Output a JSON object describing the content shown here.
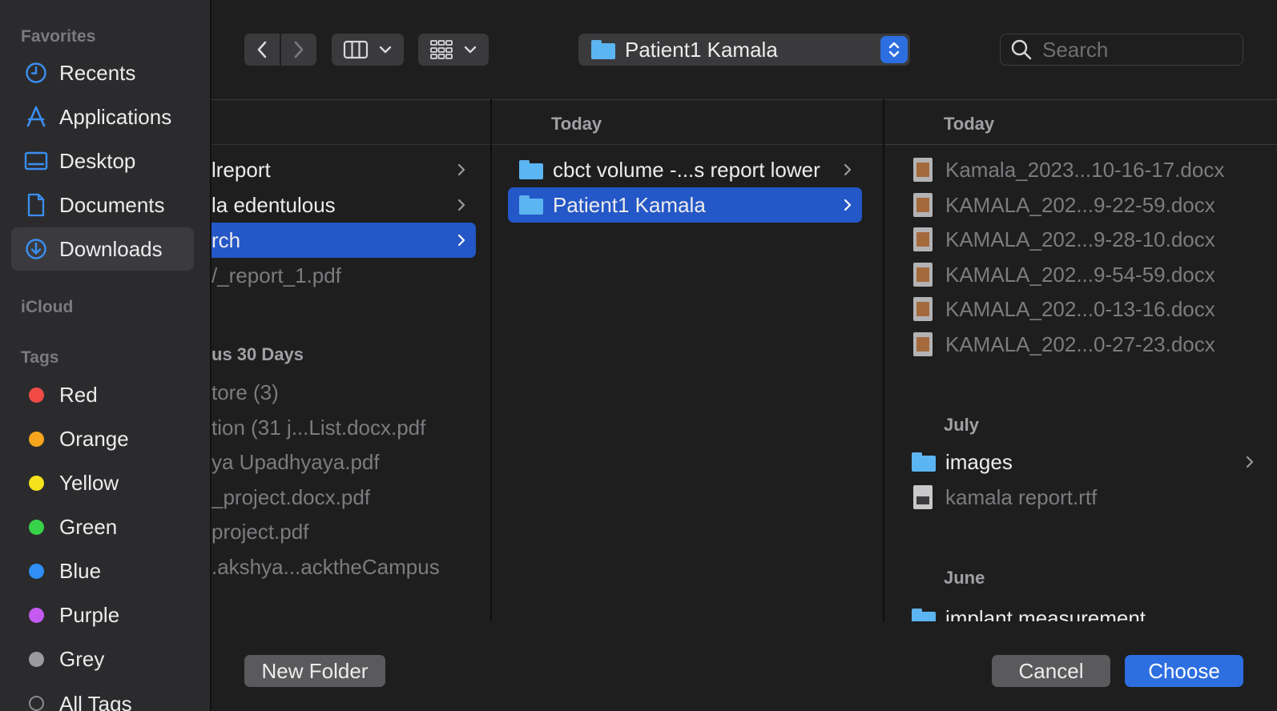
{
  "sidebar": {
    "favorites_label": "Favorites",
    "favorites": [
      {
        "label": "Recents",
        "icon": "clock-icon"
      },
      {
        "label": "Applications",
        "icon": "applications-icon"
      },
      {
        "label": "Desktop",
        "icon": "desktop-icon"
      },
      {
        "label": "Documents",
        "icon": "document-icon"
      },
      {
        "label": "Downloads",
        "icon": "download-icon",
        "selected": true
      }
    ],
    "icloud_label": "iCloud",
    "tags_label": "Tags",
    "tags": [
      {
        "label": "Red",
        "color": "#f24b45"
      },
      {
        "label": "Orange",
        "color": "#f7a51d"
      },
      {
        "label": "Yellow",
        "color": "#f5e21a"
      },
      {
        "label": "Green",
        "color": "#37d14a"
      },
      {
        "label": "Blue",
        "color": "#2f8ff7"
      },
      {
        "label": "Purple",
        "color": "#c55af0"
      },
      {
        "label": "Grey",
        "color": "#9b9b9f"
      }
    ],
    "all_tags_partial": "All Tags"
  },
  "toolbar": {
    "path_name": "Patient1 Kamala",
    "search_placeholder": "Search"
  },
  "columns": {
    "col1": {
      "rows": [
        {
          "label": "lreport",
          "folder": true
        },
        {
          "label": "la edentulous",
          "folder": true
        },
        {
          "label": "rch",
          "folder": true,
          "selected": true
        },
        {
          "label": "/_report_1.pdf",
          "dim": true
        }
      ],
      "section2": "us 30 Days",
      "rows2": [
        "tore (3)",
        "tion (31 j...List.docx.pdf",
        "ya Upadhyaya.pdf",
        "_project.docx.pdf",
        "project.pdf",
        ".akshya...acktheCampus"
      ]
    },
    "col2": {
      "header": "Today",
      "rows": [
        {
          "label": "cbct volume -...s report lower"
        },
        {
          "label": "Patient1 Kamala",
          "selected": true
        }
      ]
    },
    "col3": {
      "header": "Today",
      "files": [
        "Kamala_2023...10-16-17.docx",
        "KAMALA_202...9-22-59.docx",
        "KAMALA_202...9-28-10.docx",
        "KAMALA_202...9-54-59.docx",
        "KAMALA_202...0-13-16.docx",
        "KAMALA_202...0-27-23.docx"
      ],
      "july_label": "July",
      "july_rows": [
        {
          "label": "images"
        },
        {
          "label": "kamala report.rtf"
        }
      ],
      "june_label": "June",
      "june_partial": "implant measurement"
    }
  },
  "buttons": {
    "new_folder": "New Folder",
    "cancel": "Cancel",
    "choose": "Choose"
  },
  "colors": {
    "accent": "#2d6ee0",
    "selection": "#2457c7",
    "sidebar_bg": "#2b2b2d"
  }
}
